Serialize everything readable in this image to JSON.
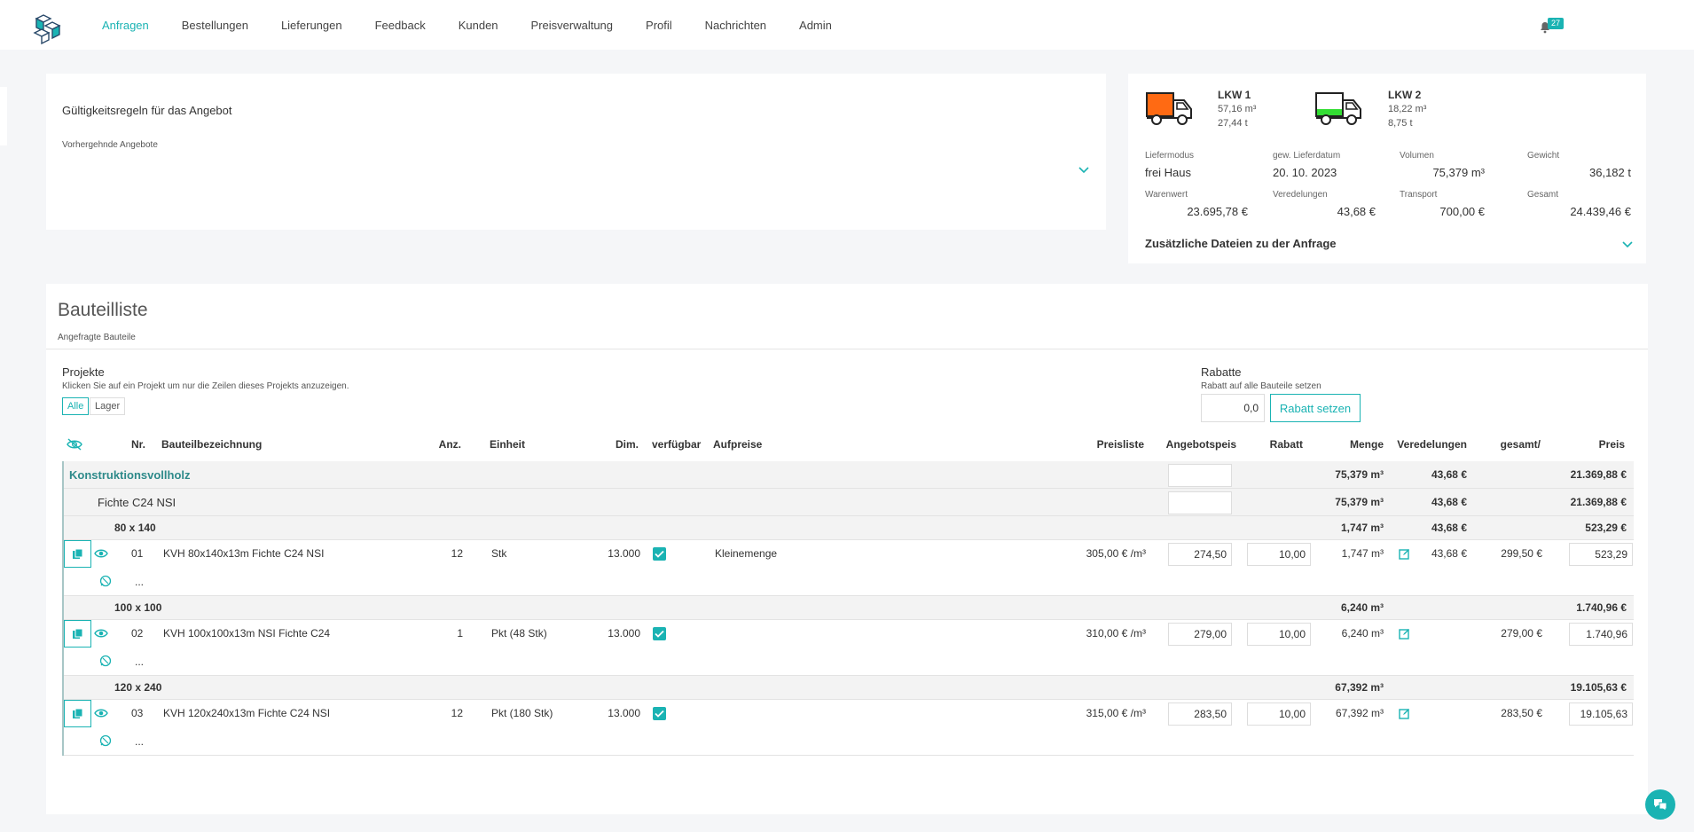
{
  "nav": {
    "items": [
      {
        "label": "Anfragen",
        "active": true
      },
      {
        "label": "Bestellungen"
      },
      {
        "label": "Lieferungen"
      },
      {
        "label": "Feedback"
      },
      {
        "label": "Kunden"
      },
      {
        "label": "Preisverwaltung"
      },
      {
        "label": "Profil"
      },
      {
        "label": "Nachrichten"
      },
      {
        "label": "Admin"
      }
    ],
    "notification_count": "27"
  },
  "validity": {
    "title": "Gültigkeitsregeln für das Angebot",
    "previous_label": "Vorhergehnde Angebote"
  },
  "summary": {
    "truck1": {
      "name": "LKW 1",
      "volume": "57,16 m³",
      "weight": "27,44 t",
      "color": "#ff6a13"
    },
    "truck2": {
      "name": "LKW 2",
      "volume": "18,22 m³",
      "weight": "8,75 t",
      "color": "#33dd33"
    },
    "liefermodus_label": "Liefermodus",
    "liefermodus": "frei Haus",
    "lieferdatum_label": "gew. Lieferdatum",
    "lieferdatum": "20. 10. 2023",
    "volumen_label": "Volumen",
    "volumen": "75,379 m³",
    "gewicht_label": "Gewicht",
    "gewicht": "36,182 t",
    "warenwert_label": "Warenwert",
    "warenwert": "23.695,78 €",
    "veredelungen_label": "Veredelungen",
    "veredelungen": "43,68 €",
    "transport_label": "Transport",
    "transport": "700,00 €",
    "gesamt_label": "Gesamt",
    "gesamt": "24.439,46 €",
    "files_label": "Zusätzliche Dateien zu der Anfrage"
  },
  "list": {
    "title": "Bauteilliste",
    "subtitle": "Angefragte Bauteile",
    "projects_title": "Projekte",
    "projects_desc": "Klicken Sie auf ein Projekt um nur die Zeilen dieses Projekts anzuzeigen.",
    "filter_all": "Alle",
    "filter_lager": "Lager",
    "rabatte_title": "Rabatte",
    "rabatte_desc": "Rabatt auf alle Bauteile setzen",
    "rabatt_value": "0,0",
    "rabatt_button": "Rabatt setzen"
  },
  "table": {
    "headers": {
      "nr": "Nr.",
      "bez": "Bauteilbezeichnung",
      "anz": "Anz.",
      "einheit": "Einheit",
      "dim": "Dim.",
      "verf": "verfügbar",
      "aufpreise": "Aufpreise",
      "preisliste": "Preisliste",
      "angebot": "Angebotspeis",
      "rabatt": "Rabatt",
      "menge": "Menge",
      "veredelungen": "Veredelungen",
      "gesamt": "gesamt/",
      "preis": "Preis"
    },
    "group": {
      "name": "Konstruktionsvollholz",
      "menge": "75,379 m³",
      "veredelungen": "43,68 €",
      "preis": "21.369,88 €"
    },
    "subgroup": {
      "name": "Fichte C24 NSI",
      "menge": "75,379 m³",
      "veredelungen": "43,68 €",
      "preis": "21.369,88 €"
    },
    "dims": [
      {
        "name": "80 x 140",
        "menge": "1,747 m³",
        "veredelungen": "43,68 €",
        "preis": "523,29 €",
        "item": {
          "nr": "01",
          "bez": "KVH 80x140x13m Fichte C24 NSI",
          "anz": "12",
          "einheit": "Stk",
          "dim": "13.000",
          "aufpreis": "Kleinemenge",
          "preisliste": "305,00 € /m³",
          "angebot": "274,50",
          "rabatt": "10,00",
          "menge": "1,747 m³",
          "veredelungen": "43,68 €",
          "gesamt": "299,50 €",
          "preis": "523,29"
        },
        "note": "..."
      },
      {
        "name": "100 x 100",
        "menge": "6,240 m³",
        "veredelungen": "",
        "preis": "1.740,96 €",
        "item": {
          "nr": "02",
          "bez": "KVH 100x100x13m NSI Fichte C24",
          "anz": "1",
          "einheit": "Pkt (48 Stk)",
          "dim": "13.000",
          "aufpreis": "",
          "preisliste": "310,00 € /m³",
          "angebot": "279,00",
          "rabatt": "10,00",
          "menge": "6,240 m³",
          "veredelungen": "",
          "gesamt": "279,00 €",
          "preis": "1.740,96"
        },
        "note": "..."
      },
      {
        "name": "120 x 240",
        "menge": "67,392 m³",
        "veredelungen": "",
        "preis": "19.105,63 €",
        "item": {
          "nr": "03",
          "bez": "KVH 120x240x13m Fichte C24 NSI",
          "anz": "12",
          "einheit": "Pkt (180 Stk)",
          "dim": "13.000",
          "aufpreis": "",
          "preisliste": "315,00 € /m³",
          "angebot": "283,50",
          "rabatt": "10,00",
          "menge": "67,392 m³",
          "veredelungen": "",
          "gesamt": "283,50 €",
          "preis": "19.105,63"
        },
        "note": "..."
      }
    ]
  },
  "colors": {
    "accent": "#1ab3b3"
  }
}
